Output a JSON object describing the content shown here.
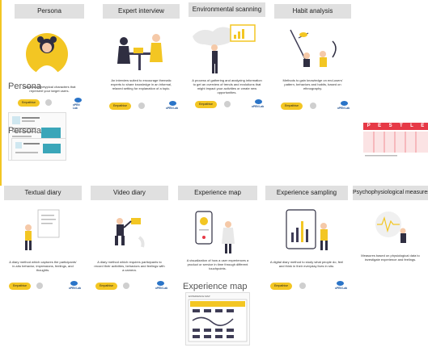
{
  "cards_row1": [
    {
      "title": "Persona",
      "desc": "Fictional archetypical characters that represent your target users.",
      "badge": "Empathise",
      "lab": "oPEN Lab"
    },
    {
      "title": "Expert interview",
      "desc": "An interview suited to encourage thematic experts to share knowledge in an informal, relaxed setting for explanation of a topic.",
      "badge": "Empathise",
      "lab": "oPEN Lab"
    },
    {
      "title": "Environmental scanning",
      "desc": "A process of gathering and analyzing information to get an overview of trends and evolutions that might impact your activities or create new opportunities.",
      "badge": "Empathise",
      "lab": "oPEN Lab"
    },
    {
      "title": "Habit analysis",
      "desc": "Methods to gain knowledge on end-users' pattern, behaviors and habits, based on ethnography.",
      "badge": "Empathise",
      "lab": "oPEN Lab"
    }
  ],
  "cards_row2": [
    {
      "title": "Textual diary",
      "desc": "A diary method which captures the participants' in-situ behavior, impressions, feelings, and thoughts.",
      "badge": "Empathise",
      "lab": "oPEN Lab"
    },
    {
      "title": "Video diary",
      "desc": "A diary method which requires participants to record their activities, behaviors and feelings with a camera.",
      "badge": "Empathise",
      "lab": "oPEN Lab"
    },
    {
      "title": "Experience map",
      "desc": "A visualization of how a user experiences a product or service in time through different touchpoints.",
      "badge": "Empathise",
      "lab": "oPEN Lab"
    },
    {
      "title": "Experience sampling",
      "desc": "A digital diary method to study what people do, feel and think in their everyday lives in situ.",
      "badge": "Empathise",
      "lab": "oPEN Lab"
    },
    {
      "title": "Psychophysiological measures",
      "desc": "Measures based on physiological data to investigate experience and feelings.",
      "badge": "Empathise",
      "lab": "oPEN Lab"
    }
  ],
  "overlays": {
    "persona_label": "Persona",
    "persona_label2": "Persona",
    "experience_map_label": "Experience map",
    "pestle_letters": [
      "P",
      "E",
      "S",
      "T",
      "L",
      "E"
    ],
    "experience_map_thumb_title": "EXPERIENCE MAP"
  },
  "colors": {
    "accent": "#f3c623",
    "title_bg": "#e0e0e0",
    "figure": "#2f2e41",
    "pestle": "#e63946"
  }
}
